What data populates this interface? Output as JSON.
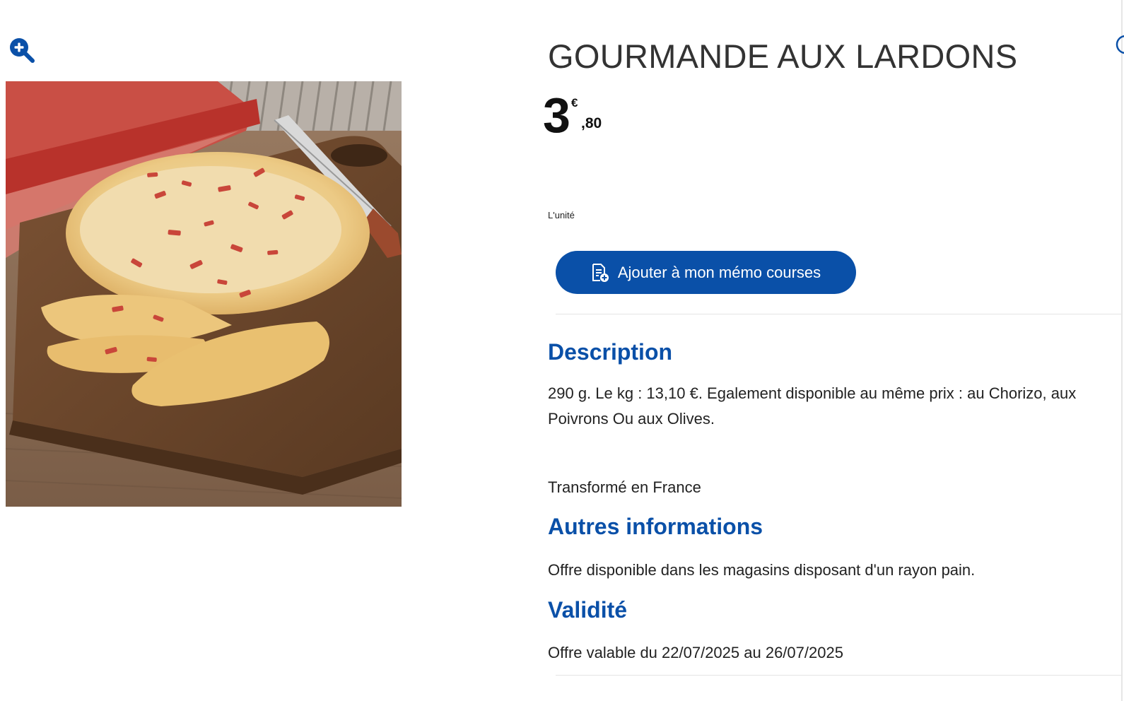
{
  "product": {
    "title": "GOURMANDE AUX LARDONS",
    "price_integer": "3",
    "price_currency": "€",
    "price_decimal": ",80",
    "unit": "L'unité",
    "image_alt": "photo-pizza-lardons"
  },
  "actions": {
    "zoom_icon": "zoom-in-icon",
    "add_to_list_label": "Ajouter à mon mémo courses",
    "add_to_list_icon": "shopping-list-add-icon"
  },
  "description": {
    "heading": "Description",
    "text_line1": "290 g. Le kg : 13,10 €. Egalement disponible au même prix : au Chorizo, aux",
    "text_line2": "Poivrons Ou aux Olives.",
    "origin": "Transformé en France"
  },
  "other_info": {
    "heading": "Autres informations",
    "text": "Offre disponible dans les magasins disposant d'un rayon pain."
  },
  "validity": {
    "heading": "Validité",
    "text": "Offre valable du 22/07/2025 au 26/07/2025"
  },
  "colors": {
    "brand_blue": "#0a50a8",
    "text": "#222222"
  }
}
